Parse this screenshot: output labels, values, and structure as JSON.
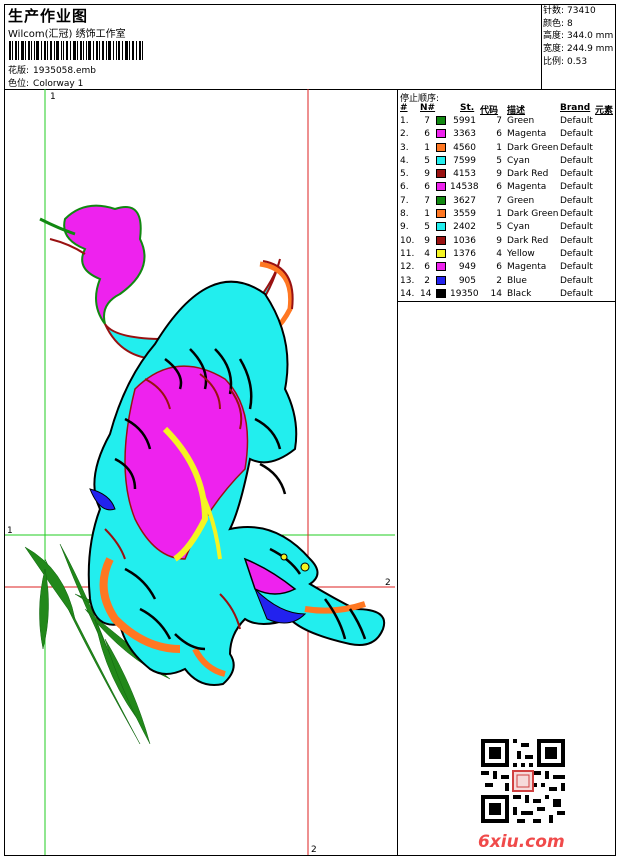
{
  "header": {
    "title": "生产作业图",
    "subtitle": "Wilcom(汇冠) 绣饰工作室",
    "design_label": "花版:",
    "design_value": "1935058.emb",
    "colorway_label": "色位:",
    "colorway_value": "Colorway 1"
  },
  "stats": [
    {
      "label": "针数:",
      "value": "73410"
    },
    {
      "label": "颜色:",
      "value": "8"
    },
    {
      "label": "高度:",
      "value": "344.0 mm"
    },
    {
      "label": "宽度:",
      "value": "244.9 mm"
    },
    {
      "label": "比例:",
      "value": "0.53"
    }
  ],
  "guides": {
    "v1_label": "1",
    "h1_label": "1",
    "v2_label": "2",
    "h2_label": "2"
  },
  "stop_sequence": {
    "title": "停止顺序:",
    "headers": {
      "idx": "#",
      "n": "N#",
      "st": "St.",
      "code": "代码",
      "desc": "描述",
      "brand": "Brand",
      "element": "元素"
    },
    "rows": [
      {
        "idx": "1.",
        "n": "7",
        "color": "#118811",
        "st": "5991",
        "code": "7",
        "desc": "Green",
        "brand": "Default"
      },
      {
        "idx": "2.",
        "n": "6",
        "color": "#ee22ee",
        "st": "3363",
        "code": "6",
        "desc": "Magenta",
        "brand": "Default"
      },
      {
        "idx": "3.",
        "n": "1",
        "color": "#ff7722",
        "st": "4560",
        "code": "1",
        "desc": "Dark Green",
        "brand": "Default"
      },
      {
        "idx": "4.",
        "n": "5",
        "color": "#22eeee",
        "st": "7599",
        "code": "5",
        "desc": "Cyan",
        "brand": "Default"
      },
      {
        "idx": "5.",
        "n": "9",
        "color": "#991111",
        "st": "4153",
        "code": "9",
        "desc": "Dark Red",
        "brand": "Default"
      },
      {
        "idx": "6.",
        "n": "6",
        "color": "#ee22ee",
        "st": "14538",
        "code": "6",
        "desc": "Magenta",
        "brand": "Default"
      },
      {
        "idx": "7.",
        "n": "7",
        "color": "#118811",
        "st": "3627",
        "code": "7",
        "desc": "Green",
        "brand": "Default"
      },
      {
        "idx": "8.",
        "n": "1",
        "color": "#ff7722",
        "st": "3559",
        "code": "1",
        "desc": "Dark Green",
        "brand": "Default"
      },
      {
        "idx": "9.",
        "n": "5",
        "color": "#22eeee",
        "st": "2402",
        "code": "5",
        "desc": "Cyan",
        "brand": "Default"
      },
      {
        "idx": "10.",
        "n": "9",
        "color": "#991111",
        "st": "1036",
        "code": "9",
        "desc": "Dark Red",
        "brand": "Default"
      },
      {
        "idx": "11.",
        "n": "4",
        "color": "#f4f422",
        "st": "1376",
        "code": "4",
        "desc": "Yellow",
        "brand": "Default"
      },
      {
        "idx": "12.",
        "n": "6",
        "color": "#ee22ee",
        "st": "949",
        "code": "6",
        "desc": "Magenta",
        "brand": "Default"
      },
      {
        "idx": "13.",
        "n": "2",
        "color": "#2222ee",
        "st": "905",
        "code": "2",
        "desc": "Blue",
        "brand": "Default"
      },
      {
        "idx": "14.",
        "n": "14",
        "color": "#000000",
        "st": "19350",
        "code": "14",
        "desc": "Black",
        "brand": "Default"
      }
    ]
  },
  "watermark": "6xiu.com",
  "colors": {
    "guide_green": "#22cc22",
    "guide_red": "#dd2222"
  }
}
